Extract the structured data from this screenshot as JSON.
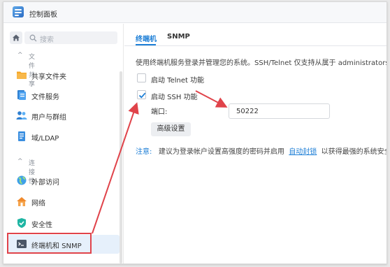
{
  "window": {
    "title": "控制面板"
  },
  "sidebar": {
    "search_placeholder": "搜索",
    "sections": [
      {
        "label": "文件共享"
      },
      {
        "label": "连接性"
      }
    ],
    "items": [
      {
        "label": "共享文件夹",
        "icon": "folder-icon"
      },
      {
        "label": "文件服务",
        "icon": "file-services-icon"
      },
      {
        "label": "用户与群组",
        "icon": "users-icon"
      },
      {
        "label": "域/LDAP",
        "icon": "domain-icon"
      },
      {
        "label": "外部访问",
        "icon": "globe-icon"
      },
      {
        "label": "网络",
        "icon": "network-icon"
      },
      {
        "label": "安全性",
        "icon": "shield-icon"
      },
      {
        "label": "终端机和 SNMP",
        "icon": "terminal-icon",
        "active": true
      }
    ]
  },
  "main": {
    "tabs": [
      {
        "label": "终端机",
        "active": true
      },
      {
        "label": "SNMP",
        "active": false
      }
    ],
    "description": "使用终端机服务登录并管理您的系统。SSH/Telnet 仅支持从属于 administrators 群组",
    "telnet": {
      "label": "启动 Telnet 功能",
      "checked": false
    },
    "ssh": {
      "label": "启动 SSH 功能",
      "checked": true
    },
    "port": {
      "label": "端口:",
      "value": "50222"
    },
    "advanced_button": "高级设置",
    "note": {
      "prefix": "注意:",
      "text_before": "建议为登录帐户设置高强度的密码并启用",
      "link": "自动封锁",
      "text_after": "以获得最强的系统安全性。"
    }
  },
  "colors": {
    "accent": "#1c7ed6",
    "annotation": "#e0434a",
    "active_bg": "#e6f0fb"
  }
}
